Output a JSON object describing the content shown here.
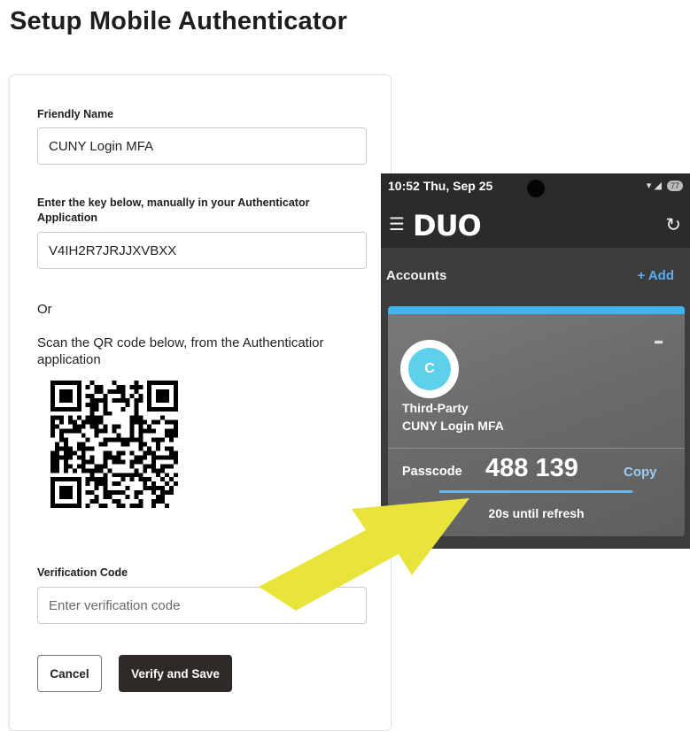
{
  "page": {
    "title": "Setup Mobile Authenticator"
  },
  "form": {
    "friendly_name_label": "Friendly Name",
    "friendly_name_value": "CUNY Login MFA",
    "key_label": "Enter the key below, manually in your Authenticator Application",
    "key_value": "V4IH2R7JRJJXVBXX",
    "or_text": "Or",
    "scan_text": "Scan the QR code below, from the Authenticatior application",
    "verification_label": "Verification Code",
    "verification_placeholder": "Enter verification code",
    "verification_value": "",
    "cancel_label": "Cancel",
    "save_label": "Verify and Save"
  },
  "phone": {
    "status_time": "10:52  Thu, Sep 25",
    "battery": "77",
    "app_logo": "DUO",
    "accounts_heading": "Accounts",
    "add_label": "+ Add",
    "account": {
      "avatar_letter": "C",
      "type": "Third-Party",
      "name": "CUNY Login MFA",
      "passcode_label": "Passcode",
      "passcode": "488 139",
      "copy_label": "Copy",
      "refresh_text": "20s until refresh",
      "timer_remaining_fraction": 0.98
    },
    "icons": {
      "menu": "hamburger-menu-icon",
      "refresh": "refresh-icon",
      "more": "more-options-icon",
      "wifi": "wifi-icon",
      "signal": "signal-icon"
    }
  },
  "colors": {
    "primary_button": "#2f2a28",
    "duo_accent": "#3fb5ef",
    "avatar": "#5fd0ea",
    "arrow": "#e8e43a"
  }
}
